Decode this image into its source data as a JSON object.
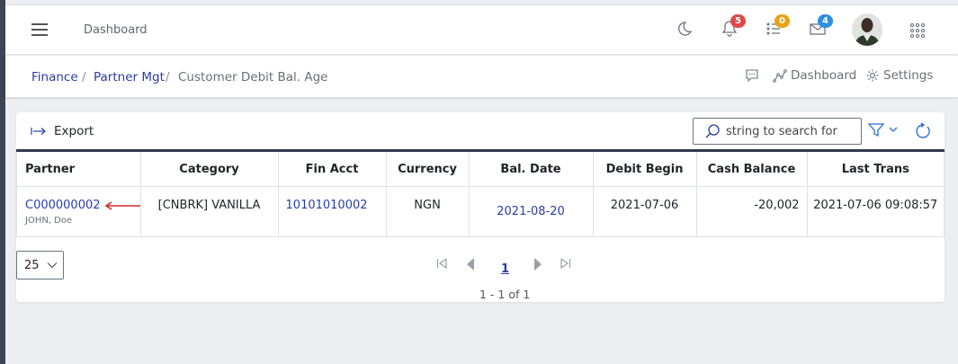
{
  "topbar": {
    "title": "Dashboard",
    "notifications_badge": "5",
    "tasks_badge": "0",
    "messages_badge": "4",
    "badge_colors": {
      "notifications": "#e04949",
      "tasks": "#e6a211",
      "messages": "#2f8fe0"
    }
  },
  "breadcrumb": {
    "items": [
      "Finance",
      "Partner Mgt",
      "Customer Debit Bal. Age"
    ],
    "separator": "/"
  },
  "breadbar_actions": {
    "dashboard_label": "Dashboard",
    "settings_label": "Settings"
  },
  "toolbar": {
    "export_label": "Export",
    "search_placeholder": "string to search for"
  },
  "table": {
    "headers": [
      "Partner",
      "Category",
      "Fin Acct",
      "Currency",
      "Bal. Date",
      "Debit Begin",
      "Cash Balance",
      "Last Trans"
    ],
    "rows": [
      {
        "partner_code": "C000000002",
        "partner_name": "JOHN, Doe",
        "category": "[CNBRK] VANILLA",
        "fin_acct": "10101010002",
        "currency": "NGN",
        "bal_date": "2021-08-20",
        "debit_begin": "2021-07-06",
        "cash_balance": "-20,002",
        "last_trans": "2021-07-06 09:08:57"
      }
    ]
  },
  "pagination": {
    "page_size": "25",
    "current_page": "1",
    "info": "1 - 1 of 1"
  },
  "colors": {
    "link": "#2a3ca8",
    "annotation_arrow": "#d22b2b",
    "table_header_border": "#2f3a4d"
  }
}
